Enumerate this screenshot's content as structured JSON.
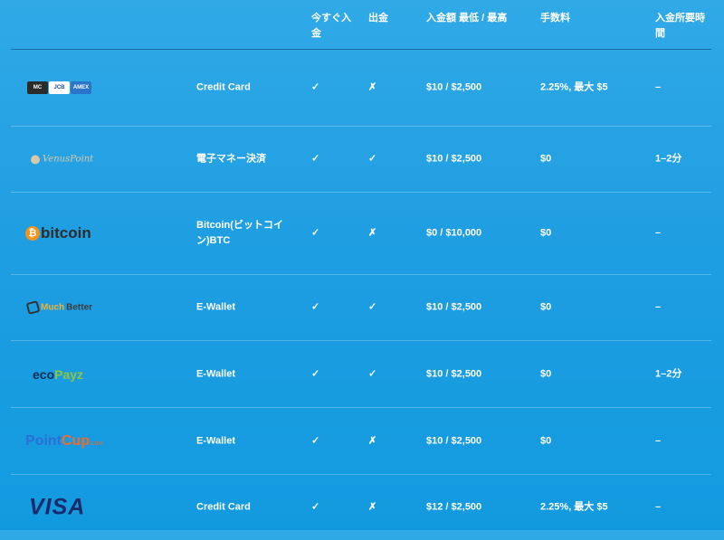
{
  "headers": {
    "method": "",
    "deposit_now": "今すぐ入金",
    "withdraw": "出金",
    "amount": "入金額 最低 / 最高",
    "fee": "手数料",
    "time": "入金所要時間"
  },
  "rows": [
    {
      "logo": "card-brands-logo",
      "logo_text": [
        "MC",
        "JCB",
        "AMEX"
      ],
      "method": "Credit Card",
      "deposit_now": "✓",
      "withdraw": "✗",
      "amount": "$10 / $2,500",
      "fee": "2.25%, 最大 $5",
      "time": "–"
    },
    {
      "logo": "venuspoint-logo",
      "logo_text": "VenusPoint",
      "method": "電子マネー決済",
      "deposit_now": "✓",
      "withdraw": "✓",
      "amount": "$10 / $2,500",
      "fee": "$0",
      "time": "1–2分"
    },
    {
      "logo": "bitcoin-logo",
      "logo_text": "bitcoin",
      "method": "Bitcoin(ビットコイン)BTC",
      "deposit_now": "✓",
      "withdraw": "✗",
      "amount": "$0 / $10,000",
      "fee": "$0",
      "time": "–"
    },
    {
      "logo": "muchbetter-logo",
      "logo_text": [
        "Much",
        "Better"
      ],
      "method": "E-Wallet",
      "deposit_now": "✓",
      "withdraw": "✓",
      "amount": "$10 / $2,500",
      "fee": "$0",
      "time": "–"
    },
    {
      "logo": "ecopayz-logo",
      "logo_text": [
        "eco",
        "Payz"
      ],
      "method": "E-Wallet",
      "deposit_now": "✓",
      "withdraw": "✓",
      "amount": "$10 / $2,500",
      "fee": "$0",
      "time": "1–2分"
    },
    {
      "logo": "pointcup-logo",
      "logo_text": [
        "Point",
        "Cup",
        ".com"
      ],
      "method": "E-Wallet",
      "deposit_now": "✓",
      "withdraw": "✗",
      "amount": "$10 / $2,500",
      "fee": "$0",
      "time": "–"
    },
    {
      "logo": "visa-logo",
      "logo_text": "VISA",
      "method": "Credit Card",
      "deposit_now": "✓",
      "withdraw": "✗",
      "amount": "$12 / $2,500",
      "fee": "2.25%, 最大 $5",
      "time": "–"
    }
  ],
  "colors": {
    "background_top": "#30a9e6",
    "background_bottom": "#129adf",
    "text": "#ffffff",
    "bitcoin_orange": "#f7931a",
    "visa_navy": "#1a2b6b"
  }
}
